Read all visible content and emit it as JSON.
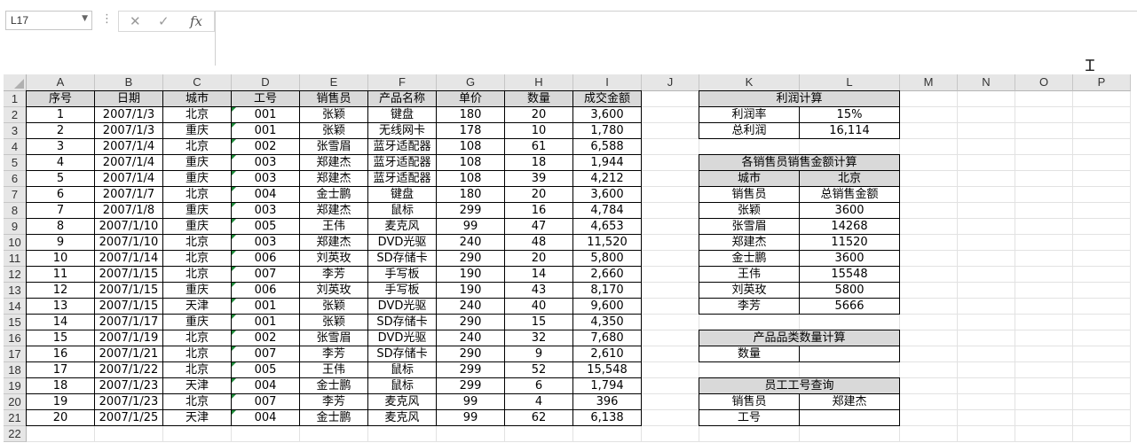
{
  "name_box": {
    "value": "L17"
  },
  "formula_bar": {
    "cancel_symbol": "✕",
    "enter_symbol": "✓",
    "fx_label": "fx",
    "content": ""
  },
  "columns": [
    "A",
    "B",
    "C",
    "D",
    "E",
    "F",
    "G",
    "H",
    "I",
    "J",
    "K",
    "L",
    "M",
    "N",
    "O",
    "P"
  ],
  "rows": [
    "1",
    "2",
    "3",
    "4",
    "5",
    "6",
    "7",
    "8",
    "9",
    "10",
    "11",
    "12",
    "13",
    "14",
    "15",
    "16",
    "17",
    "18",
    "19",
    "20",
    "21",
    "22"
  ],
  "main_table": {
    "headers": [
      "序号",
      "日期",
      "城市",
      "工号",
      "销售员",
      "产品名称",
      "单价",
      "数量",
      "成交金额"
    ],
    "rows": [
      [
        "1",
        "2007/1/3",
        "北京",
        "001",
        "张颖",
        "键盘",
        "180",
        "20",
        "3,600"
      ],
      [
        "2",
        "2007/1/3",
        "重庆",
        "001",
        "张颖",
        "无线网卡",
        "178",
        "10",
        "1,780"
      ],
      [
        "3",
        "2007/1/4",
        "北京",
        "002",
        "张雪眉",
        "蓝牙适配器",
        "108",
        "61",
        "6,588"
      ],
      [
        "4",
        "2007/1/4",
        "重庆",
        "003",
        "郑建杰",
        "蓝牙适配器",
        "108",
        "18",
        "1,944"
      ],
      [
        "5",
        "2007/1/4",
        "重庆",
        "003",
        "郑建杰",
        "蓝牙适配器",
        "108",
        "39",
        "4,212"
      ],
      [
        "6",
        "2007/1/7",
        "北京",
        "004",
        "金士鹏",
        "键盘",
        "180",
        "20",
        "3,600"
      ],
      [
        "7",
        "2007/1/8",
        "重庆",
        "003",
        "郑建杰",
        "鼠标",
        "299",
        "16",
        "4,784"
      ],
      [
        "8",
        "2007/1/10",
        "重庆",
        "005",
        "王伟",
        "麦克风",
        "99",
        "47",
        "4,653"
      ],
      [
        "9",
        "2007/1/10",
        "北京",
        "003",
        "郑建杰",
        "DVD光驱",
        "240",
        "48",
        "11,520"
      ],
      [
        "10",
        "2007/1/14",
        "北京",
        "006",
        "刘英玫",
        "SD存储卡",
        "290",
        "20",
        "5,800"
      ],
      [
        "11",
        "2007/1/15",
        "北京",
        "007",
        "李芳",
        "手写板",
        "190",
        "14",
        "2,660"
      ],
      [
        "12",
        "2007/1/15",
        "重庆",
        "006",
        "刘英玫",
        "手写板",
        "190",
        "43",
        "8,170"
      ],
      [
        "13",
        "2007/1/15",
        "天津",
        "001",
        "张颖",
        "DVD光驱",
        "240",
        "40",
        "9,600"
      ],
      [
        "14",
        "2007/1/17",
        "重庆",
        "001",
        "张颖",
        "SD存储卡",
        "290",
        "15",
        "4,350"
      ],
      [
        "15",
        "2007/1/19",
        "北京",
        "002",
        "张雪眉",
        "DVD光驱",
        "240",
        "32",
        "7,680"
      ],
      [
        "16",
        "2007/1/21",
        "北京",
        "007",
        "李芳",
        "SD存储卡",
        "290",
        "9",
        "2,610"
      ],
      [
        "17",
        "2007/1/22",
        "北京",
        "005",
        "王伟",
        "鼠标",
        "299",
        "52",
        "15,548"
      ],
      [
        "18",
        "2007/1/23",
        "天津",
        "004",
        "金士鹏",
        "鼠标",
        "299",
        "6",
        "1,794"
      ],
      [
        "19",
        "2007/1/23",
        "北京",
        "007",
        "李芳",
        "麦克风",
        "99",
        "4",
        "396"
      ],
      [
        "20",
        "2007/1/25",
        "天津",
        "004",
        "金士鹏",
        "麦克风",
        "99",
        "62",
        "6,138"
      ]
    ]
  },
  "profit_table": {
    "title": "利润计算",
    "rows": [
      [
        "利润率",
        "15%"
      ],
      [
        "总利润",
        "16,114"
      ]
    ]
  },
  "sales_table": {
    "title": "各销售员销售金额计算",
    "city_label": "城市",
    "city_value": "北京",
    "col_headers": [
      "销售员",
      "总销售金额"
    ],
    "rows": [
      [
        "张颖",
        "3600"
      ],
      [
        "张雪眉",
        "14268"
      ],
      [
        "郑建杰",
        "11520"
      ],
      [
        "金士鹏",
        "3600"
      ],
      [
        "王伟",
        "15548"
      ],
      [
        "刘英玫",
        "5800"
      ],
      [
        "李芳",
        "5666"
      ]
    ]
  },
  "category_table": {
    "title": "产品品类数量计算",
    "label": "数量",
    "value": ""
  },
  "employee_table": {
    "title": "员工工号查询",
    "rows": [
      [
        "销售员",
        "郑建杰"
      ],
      [
        "工号",
        ""
      ]
    ]
  },
  "colors": {
    "header_fill": "#d9d9d9",
    "text_tri": "#1e8a3a",
    "grid_header": "#e6e6e6"
  }
}
